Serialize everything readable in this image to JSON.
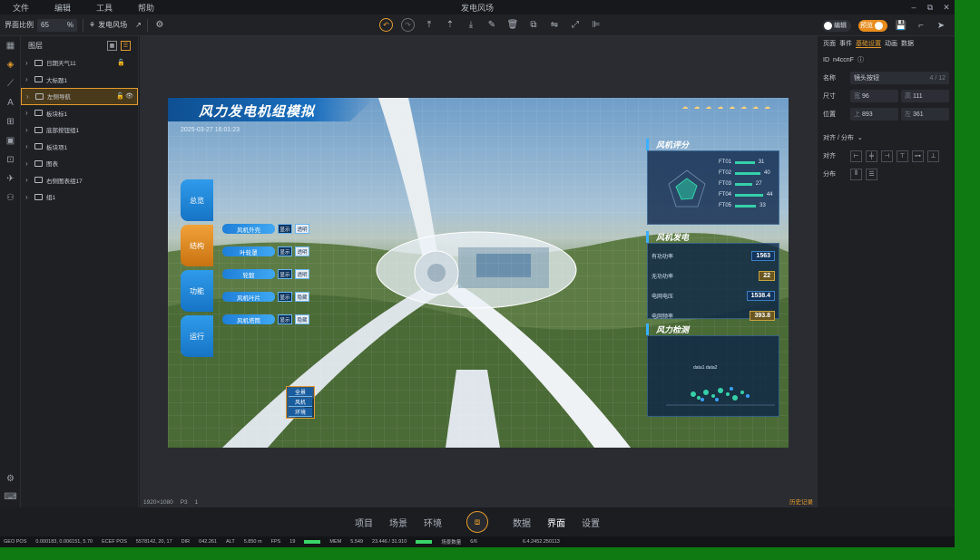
{
  "window": {
    "title": "发电风场",
    "menus": [
      "文件",
      "编辑",
      "工具",
      "帮助"
    ],
    "controls": [
      "–",
      "⧉",
      "✕"
    ]
  },
  "toolbar": {
    "scale_label": "界面比例",
    "scale_value": "65",
    "scale_unit": "%",
    "wind_label": "发电风场",
    "edit_toggle": "编辑",
    "preview_toggle": "预览"
  },
  "layers": {
    "title": "图层",
    "items": [
      {
        "label": "日期天气11",
        "locked": true
      },
      {
        "label": "大标题1"
      },
      {
        "label": "左侧导航",
        "selected": true,
        "locked": true,
        "visible": true
      },
      {
        "label": "板块标1"
      },
      {
        "label": "底部按钮组1"
      },
      {
        "label": "板块项1"
      },
      {
        "label": "图表"
      },
      {
        "label": "右侧图表组17"
      },
      {
        "label": "组1"
      }
    ]
  },
  "scene": {
    "title": "风力发电机组模拟",
    "datetime": "2025-03-27 16:01:23",
    "weather": "☁ ☁ ☁ ☁ ☁ ☁ ☁ ☁",
    "side_tabs": [
      "总览",
      "结构",
      "功能",
      "运行"
    ],
    "controls": [
      {
        "name": "风机外壳",
        "a": "显示",
        "b": "透明"
      },
      {
        "name": "叶轮罩",
        "a": "显示",
        "b": "透明"
      },
      {
        "name": "轮毂",
        "a": "显示",
        "b": "透明"
      },
      {
        "name": "风机叶片",
        "a": "显示",
        "b": "隐藏"
      },
      {
        "name": "风机塔筒",
        "a": "显示",
        "b": "隐藏"
      }
    ],
    "mini_menu": [
      "全景",
      "风机",
      "环境"
    ],
    "score_panel": {
      "title": "风机评分",
      "items": [
        {
          "name": "FT01",
          "value": "31"
        },
        {
          "name": "FT02",
          "value": "40"
        },
        {
          "name": "FT03",
          "value": "27"
        },
        {
          "name": "FT04",
          "value": "44"
        },
        {
          "name": "FT05",
          "value": "33"
        }
      ]
    },
    "gen_panel": {
      "title": "风机发电",
      "rows": [
        {
          "label": "有功功率",
          "value": "1563"
        },
        {
          "label": "无功功率",
          "value": "22"
        },
        {
          "label": "电网电压",
          "value": "1538.4"
        },
        {
          "label": "电网频率",
          "value": "393.8"
        }
      ]
    },
    "monitor_panel": {
      "title": "风力检测",
      "legend": "data1 data2"
    },
    "status": "1920×1080",
    "status2": "P3",
    "status3": "1",
    "history": "历史记录"
  },
  "props": {
    "tabs": [
      "页面",
      "事件",
      "基础设置",
      "动画",
      "数据"
    ],
    "active_tab": "基础设置",
    "id_label": "ID",
    "id_value": "n4ccnF",
    "name_label": "名称",
    "name_value": "镜头按钮",
    "name_count": "4 / 12",
    "size_label": "尺寸",
    "width_label": "宽",
    "width_value": "96",
    "height_label": "高",
    "height_value": "111",
    "pos_label": "位置",
    "top_label": "上",
    "top_value": "893",
    "left_label": "左",
    "left_value": "361",
    "align_section": "对齐 / 分布",
    "align_label": "对齐",
    "dist_label": "分布"
  },
  "bottom_nav": [
    "项目",
    "场景",
    "环境",
    "数据",
    "界面",
    "设置"
  ],
  "bottom_nav_active": "界面",
  "statusbar": {
    "geo": "GEO POS",
    "geo_val": "0.000183, 0.006151, 5.70",
    "ecef": "ECEF POS",
    "ecef_val": "5578142, 20, 17",
    "dir": "DIR",
    "dir_val": "042.261",
    "alt": "ALT",
    "alt_val": "5.850 m",
    "fps": "FPS",
    "fps_val": "19",
    "mem": "MEM",
    "mem_val": "5.549",
    "mem_val2": "23.446 / 31.910",
    "light": "场景数量",
    "light_val": "6/6",
    "coords": "6.4.2452.250113"
  }
}
